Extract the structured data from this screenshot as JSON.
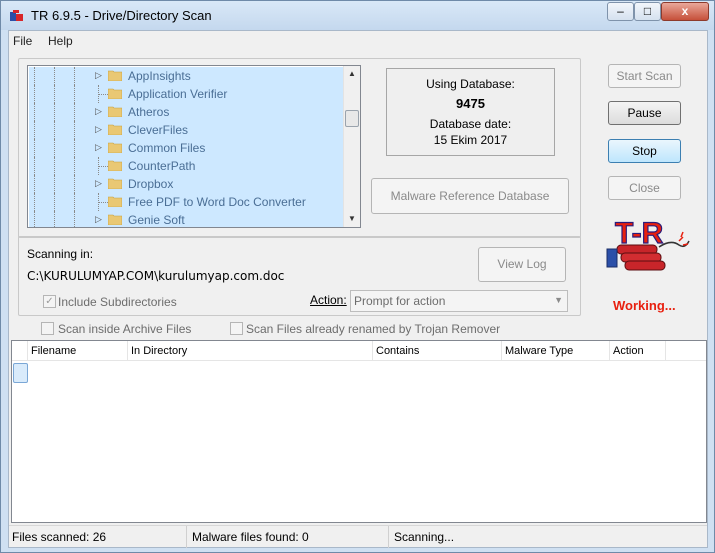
{
  "window": {
    "title": "TR 6.9.5  -  Drive/Directory Scan",
    "controls": {
      "minimize": "–",
      "maximize": "□",
      "close": "x"
    }
  },
  "menu": [
    "File",
    "Help"
  ],
  "folder_tree": {
    "items": [
      {
        "label": "AppInsights",
        "expandable": true
      },
      {
        "label": "Application Verifier",
        "expandable": false
      },
      {
        "label": "Atheros",
        "expandable": true
      },
      {
        "label": "CleverFiles",
        "expandable": true
      },
      {
        "label": "Common Files",
        "expandable": true
      },
      {
        "label": "CounterPath",
        "expandable": false
      },
      {
        "label": "Dropbox",
        "expandable": true
      },
      {
        "label": "Free PDF to Word Doc Converter",
        "expandable": false
      },
      {
        "label": "Genie Soft",
        "expandable": true
      }
    ]
  },
  "database": {
    "using_label": "Using Database:",
    "number": "9475",
    "date_label": "Database date:",
    "date": "15 Ekim 2017"
  },
  "buttons": {
    "start_scan": "Start Scan",
    "pause": "Pause",
    "stop": "Stop",
    "close": "Close",
    "malware_db": "Malware Reference Database",
    "view_log": "View Log"
  },
  "scanning": {
    "label": "Scanning in:",
    "path": "C:\\KURULUMYAP.COM\\kurulumyap.com.doc"
  },
  "options": {
    "include_subdirs": "Include Subdirectories",
    "action_label": "Action:",
    "action_value": "Prompt for action",
    "scan_archive": "Scan inside Archive Files",
    "scan_renamed": "Scan Files already renamed by Trojan Remover"
  },
  "logo": {
    "text": "T-R"
  },
  "status_working": "Working...",
  "results": {
    "columns": [
      "Filename",
      "In Directory",
      "Contains",
      "Malware Type",
      "Action"
    ]
  },
  "statusbar": {
    "files_scanned": "Files scanned: 26",
    "malware_found": "Malware files found: 0",
    "state": "Scanning..."
  },
  "colors": {
    "accent_red": "#e8200f",
    "tree_selection": "#cde8ff",
    "window_frame": "#cfe0f2"
  }
}
